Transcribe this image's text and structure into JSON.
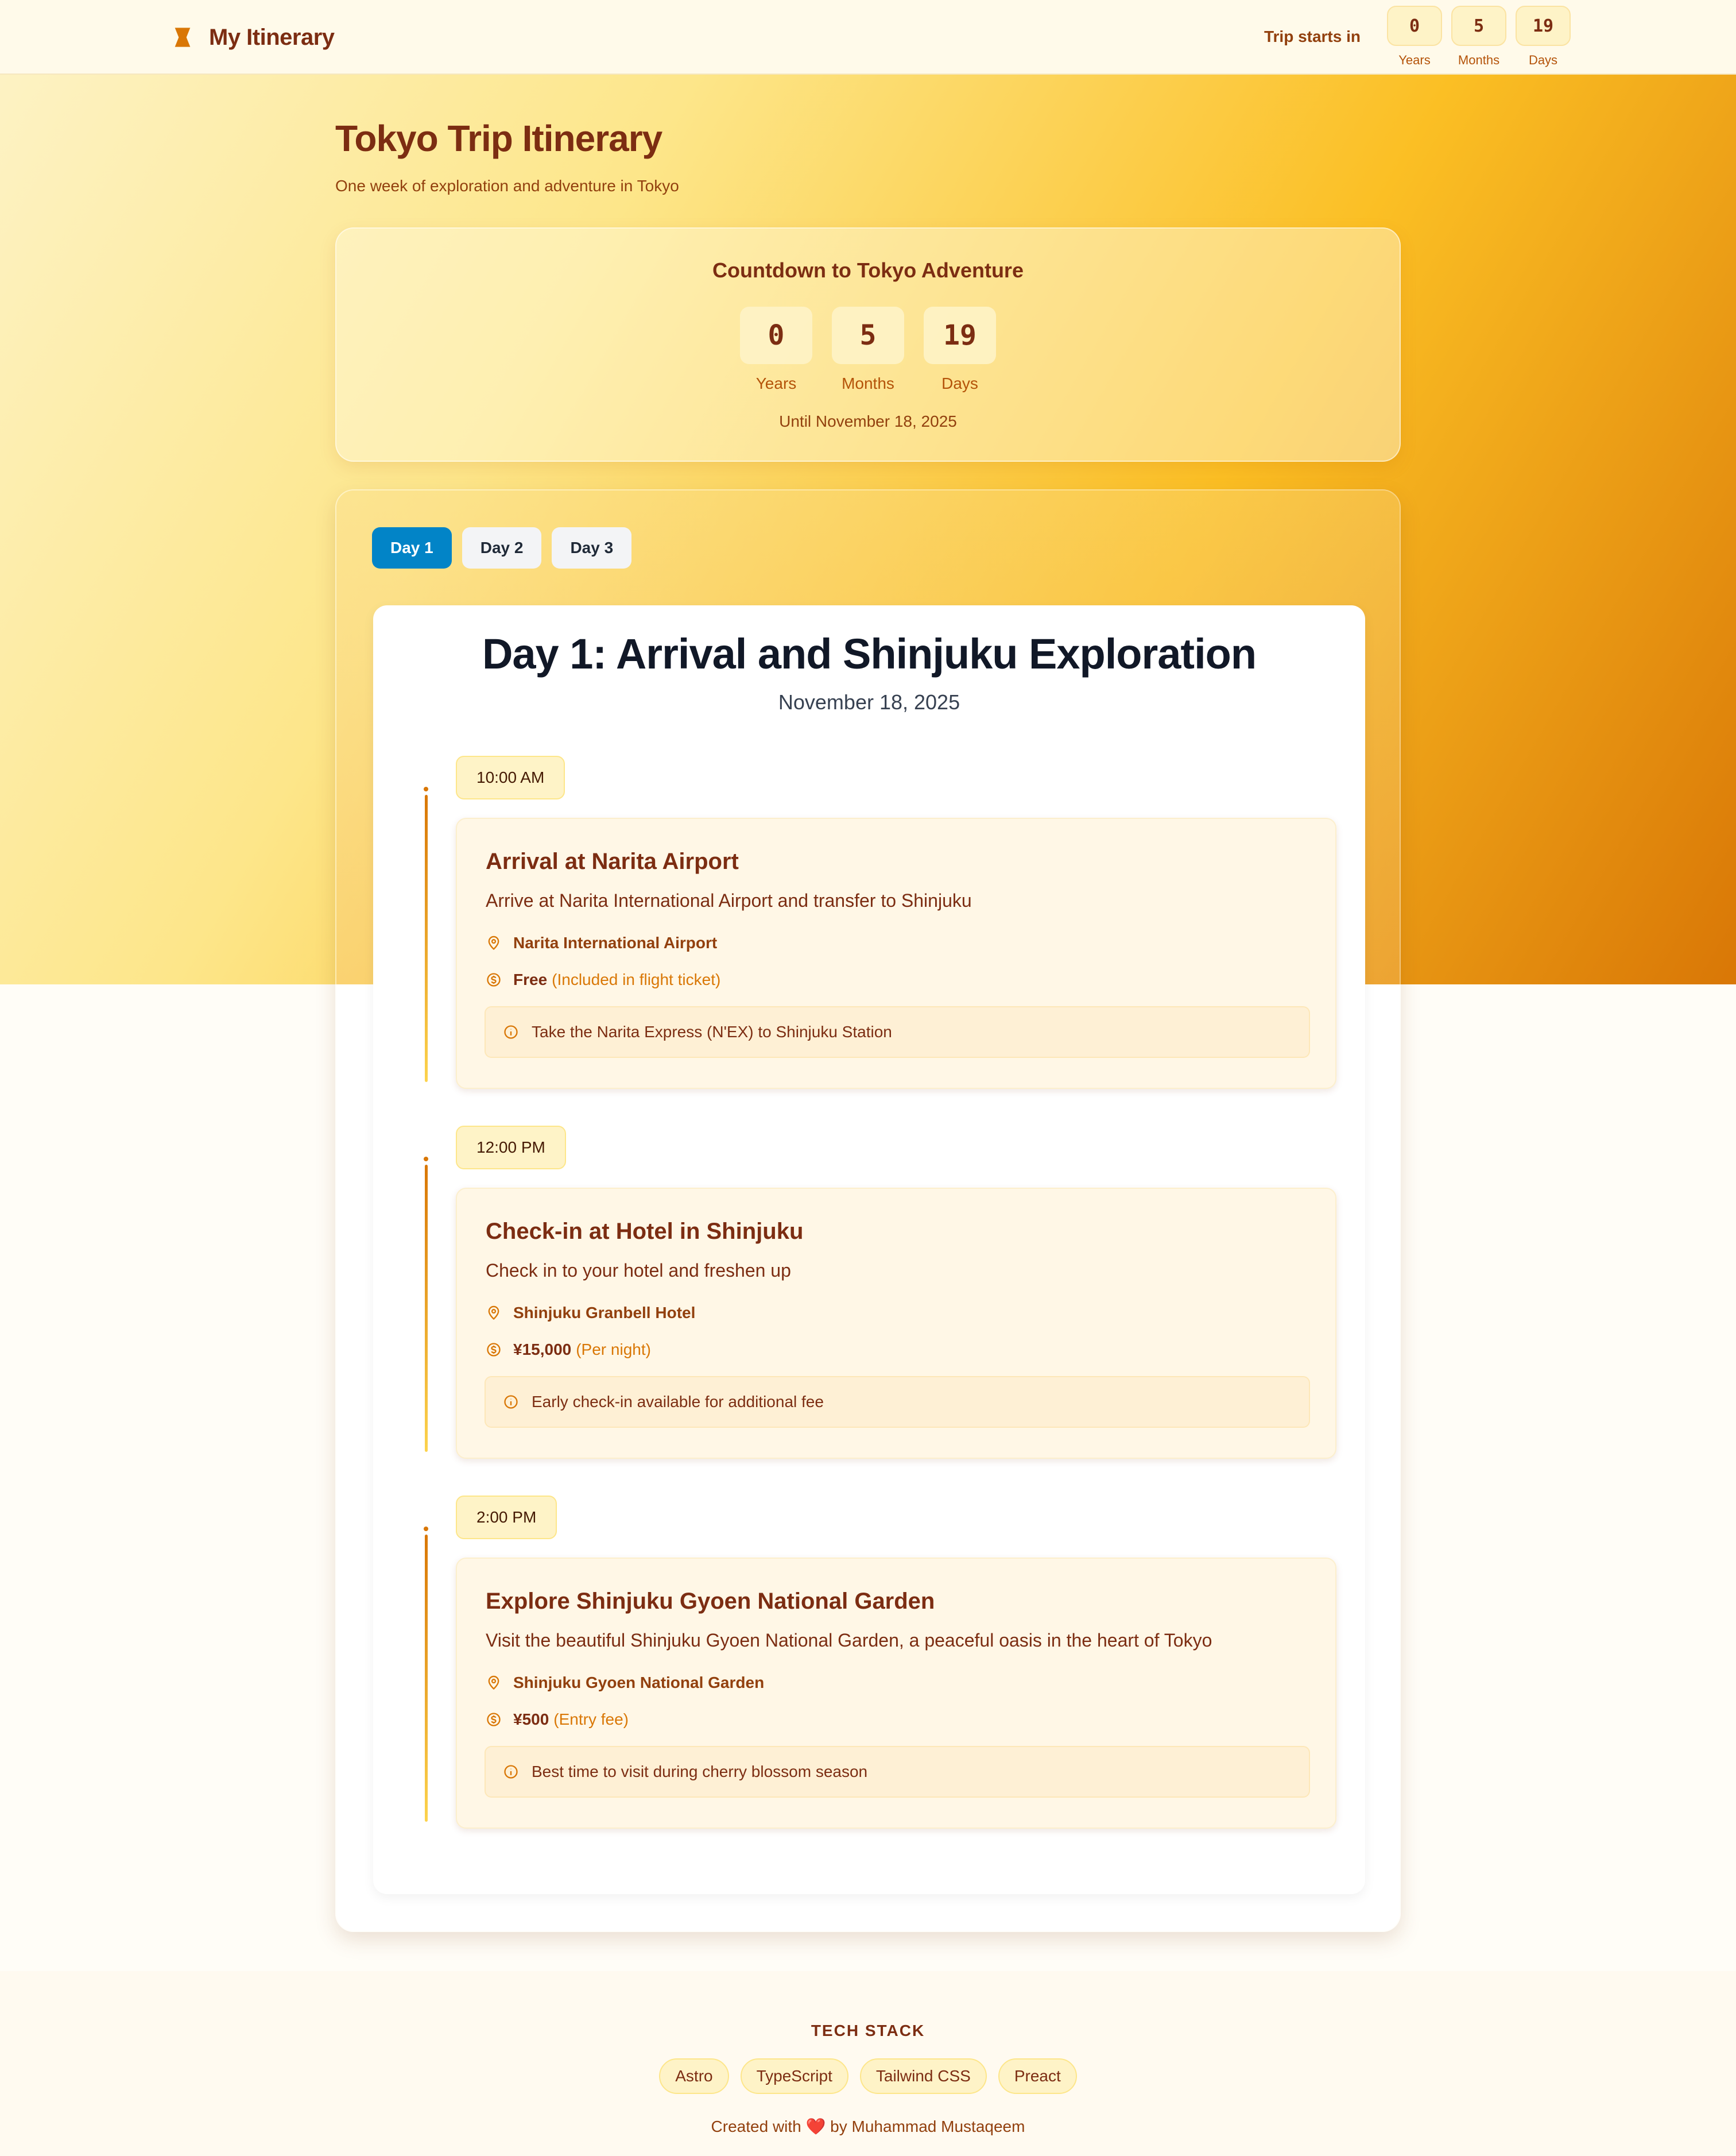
{
  "header": {
    "brand": "My Itinerary",
    "countdown_label": "Trip starts in",
    "countdown": [
      {
        "value": "0",
        "label": "Years"
      },
      {
        "value": "5",
        "label": "Months"
      },
      {
        "value": "19",
        "label": "Days"
      }
    ]
  },
  "page": {
    "title": "Tokyo Trip Itinerary",
    "subtitle": "One week of exploration and adventure in Tokyo"
  },
  "countdown_card": {
    "title": "Countdown to Tokyo Adventure",
    "units": [
      {
        "value": "0",
        "label": "Years"
      },
      {
        "value": "5",
        "label": "Months"
      },
      {
        "value": "19",
        "label": "Days"
      }
    ],
    "until": "Until November 18, 2025"
  },
  "tabs": [
    {
      "label": "Day 1",
      "active": true
    },
    {
      "label": "Day 2",
      "active": false
    },
    {
      "label": "Day 3",
      "active": false
    }
  ],
  "day": {
    "title": "Day 1: Arrival and Shinjuku Exploration",
    "date": "November 18, 2025",
    "activities": [
      {
        "time": "10:00 AM",
        "title": "Arrival at Narita Airport",
        "description": "Arrive at Narita International Airport and transfer to Shinjuku",
        "location": "Narita International Airport",
        "cost": "Free",
        "cost_note": "(Included in flight ticket)",
        "tip": "Take the Narita Express (N'EX) to Shinjuku Station"
      },
      {
        "time": "12:00 PM",
        "title": "Check-in at Hotel in Shinjuku",
        "description": "Check in to your hotel and freshen up",
        "location": "Shinjuku Granbell Hotel",
        "cost": "¥15,000",
        "cost_note": "(Per night)",
        "tip": "Early check-in available for additional fee"
      },
      {
        "time": "2:00 PM",
        "title": "Explore Shinjuku Gyoen National Garden",
        "description": "Visit the beautiful Shinjuku Gyoen National Garden, a peaceful oasis in the heart of Tokyo",
        "location": "Shinjuku Gyoen National Garden",
        "cost": "¥500",
        "cost_note": "(Entry fee)",
        "tip": "Best time to visit during cherry blossom season"
      }
    ]
  },
  "footer": {
    "title": "TECH STACK",
    "chips": [
      "Astro",
      "TypeScript",
      "Tailwind CSS",
      "Preact"
    ],
    "credit_prefix": "Created with",
    "credit_heart": "❤️",
    "credit_suffix": "by Muhammad Mustaqeem"
  },
  "colors": {
    "brand": "#7c2d12",
    "accent": "#d97706",
    "active_tab": "#0284c7"
  },
  "icons": {
    "brand": "hourglass-icon",
    "location": "map-pin-icon",
    "cost": "dollar-circle-icon",
    "tip": "info-icon"
  }
}
